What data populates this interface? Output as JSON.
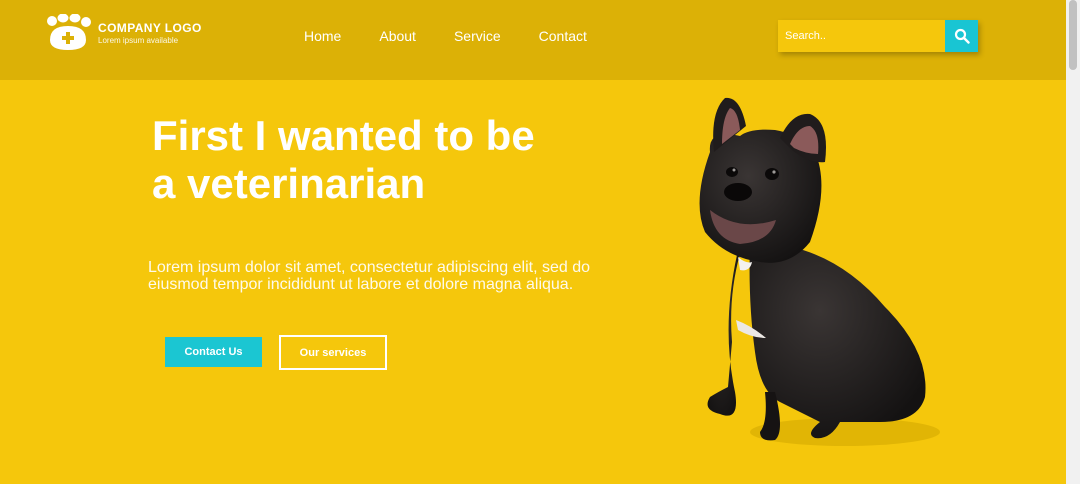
{
  "header": {
    "logo_title": "COMPANY LOGO",
    "logo_tagline": "Lorem ipsum available",
    "logo_icon": "paw-icon"
  },
  "nav": {
    "items": [
      {
        "label": "Home"
      },
      {
        "label": "About"
      },
      {
        "label": "Service"
      },
      {
        "label": "Contact"
      }
    ]
  },
  "search": {
    "placeholder": "Search..",
    "icon": "search-icon"
  },
  "hero": {
    "title_line1": "First I wanted to be",
    "title_line2": "a veterinarian",
    "body": "Lorem ipsum dolor sit amet, consectetur adipiscing elit, sed do eiusmod tempor incididunt ut labore et dolore magna aliqua.",
    "primary_button": "Contact Us",
    "secondary_button": "Our services",
    "image": "french-bulldog-photo"
  },
  "colors": {
    "background": "#f5c70c",
    "header": "#dcb106",
    "accent": "#1bc6d2",
    "text": "#ffffff"
  }
}
